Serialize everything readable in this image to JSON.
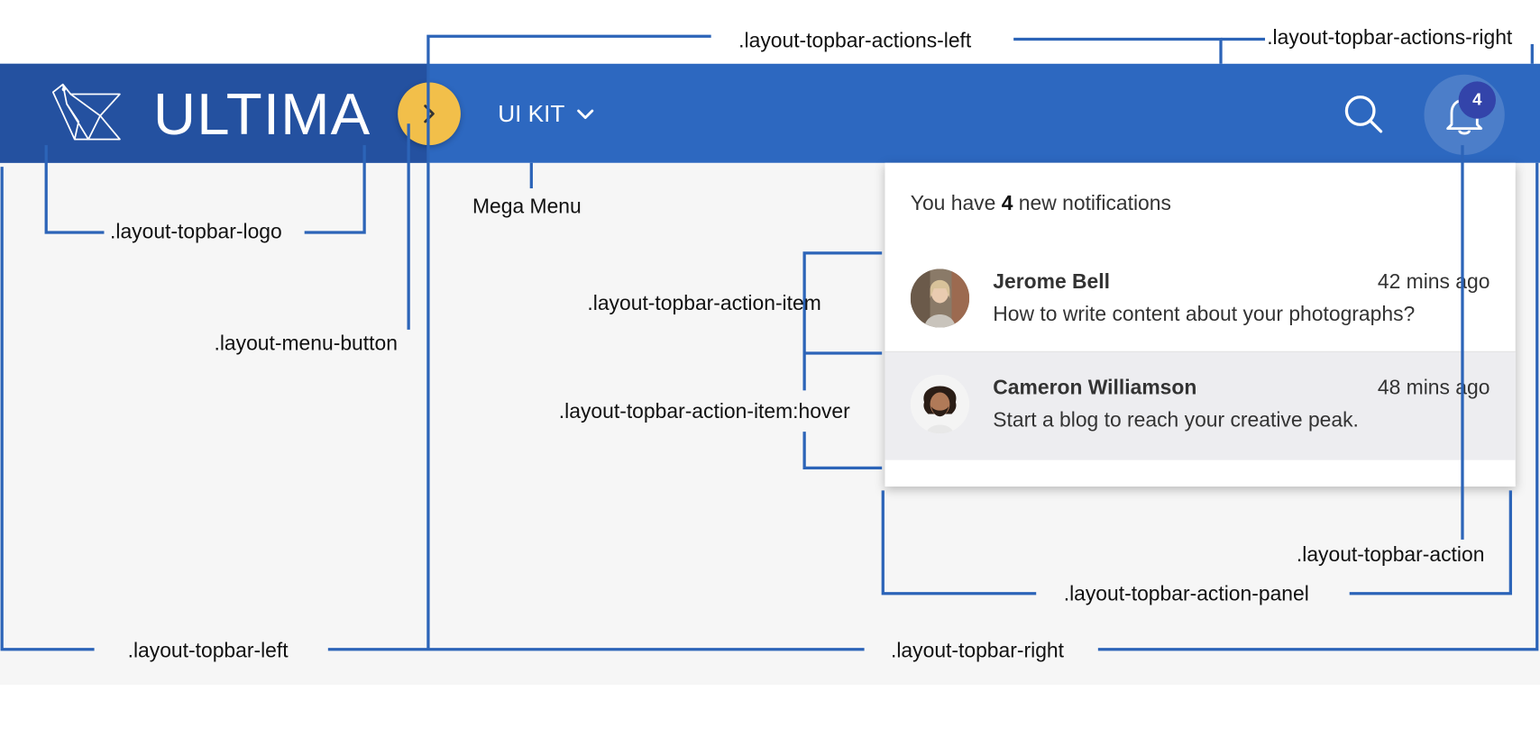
{
  "topbar": {
    "logo_text": "ULTIMA",
    "mega_menu_label": "UI KIT",
    "notification_count": "4",
    "colors": {
      "topbar": "#2d68c0",
      "topbar_left": "#2451a0",
      "menu_button": "#f2bf4a",
      "badge": "#3344aa",
      "leader_lines": "#2c64b8"
    },
    "icons": {
      "logo": "bird-logo-icon",
      "menu_button": "chevron-right-icon",
      "mega_menu": "chevron-down-icon",
      "search": "search-icon",
      "notifications": "bell-icon"
    }
  },
  "panel": {
    "header_prefix": "You have",
    "header_count": "4",
    "header_suffix": "new notifications",
    "notifications": [
      {
        "name": "Jerome Bell",
        "time": "42 mins ago",
        "message": "How to write content about your photographs?"
      },
      {
        "name": "Cameron Williamson",
        "time": "48 mins ago",
        "message": "Start a blog to reach your creative peak."
      }
    ]
  },
  "annotations": {
    "actions_left": ".layout-topbar-actions-left",
    "actions_right": ".layout-topbar-actions-right",
    "logo": ".layout-topbar-logo",
    "mega_menu": "Mega Menu",
    "action_item": ".layout-topbar-action-item",
    "menu_button": ".layout-menu-button",
    "action_item_hover": ".layout-topbar-action-item:hover",
    "action": ".layout-topbar-action",
    "action_panel": ".layout-topbar-action-panel",
    "topbar_left": ".layout-topbar-left",
    "topbar_right": ".layout-topbar-right"
  }
}
